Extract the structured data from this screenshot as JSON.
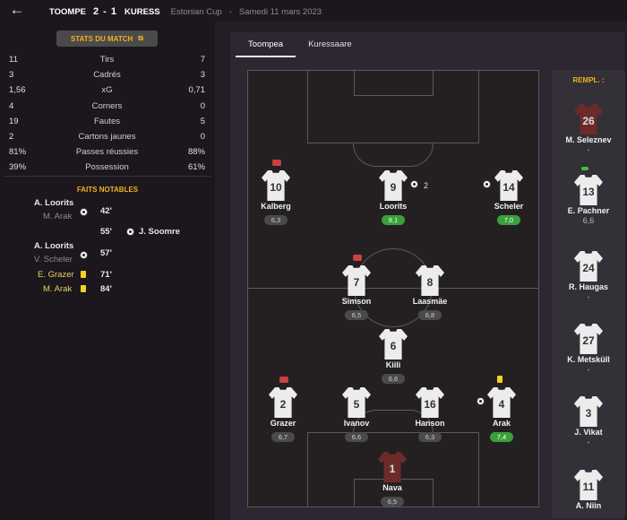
{
  "header": {
    "home": "TOOMPE",
    "score": "2 - 1",
    "away": "KURESS",
    "competition": "Estonian Cup",
    "date": "Samedi 11 mars 2023"
  },
  "stats_button": "STATS DU MATCH",
  "stats": [
    {
      "h": "11",
      "label": "Tirs",
      "a": "7"
    },
    {
      "h": "3",
      "label": "Cadrés",
      "a": "3"
    },
    {
      "h": "1,56",
      "label": "xG",
      "a": "0,71"
    },
    {
      "h": "4",
      "label": "Corners",
      "a": "0"
    },
    {
      "h": "19",
      "label": "Fautes",
      "a": "5"
    },
    {
      "h": "2",
      "label": "Cartons jaunes",
      "a": "0"
    },
    {
      "h": "81%",
      "label": "Passes réussies",
      "a": "88%"
    },
    {
      "h": "39%",
      "label": "Possession",
      "a": "61%"
    }
  ],
  "events_header": "FAITS NOTABLES",
  "events": {
    "e1_scorer": "A. Loorits",
    "e1_assist": "M. Arak",
    "e1_min": "42'",
    "e2_min": "55'",
    "e2_scorer": "J. Soomre",
    "e3_scorer": "A. Loorits",
    "e3_assist": "V. Scheler",
    "e3_min": "57'",
    "e4_player": "E. Grazer",
    "e4_min": "71'",
    "e5_player": "M. Arak",
    "e5_min": "84'"
  },
  "tabs": [
    "Toompea",
    "Kuressaare"
  ],
  "lineup": {
    "p10": {
      "num": "10",
      "name": "Kalberg",
      "rating": "6,3"
    },
    "p9": {
      "num": "9",
      "name": "Loorits",
      "rating": "9,1",
      "goals": "2"
    },
    "p14": {
      "num": "14",
      "name": "Scheler",
      "rating": "7,0"
    },
    "p7": {
      "num": "7",
      "name": "Simson",
      "rating": "6,5"
    },
    "p8": {
      "num": "8",
      "name": "Laasmäe",
      "rating": "6,8"
    },
    "p6": {
      "num": "6",
      "name": "Kiili",
      "rating": "6,6"
    },
    "p2": {
      "num": "2",
      "name": "Grazer",
      "rating": "6,7"
    },
    "p5": {
      "num": "5",
      "name": "Ivanov",
      "rating": "6,6"
    },
    "p16": {
      "num": "16",
      "name": "Hanson",
      "rating": "6,3"
    },
    "p4": {
      "num": "4",
      "name": "Arak",
      "rating": "7,4"
    },
    "p1": {
      "num": "1",
      "name": "Nava",
      "rating": "6,5"
    }
  },
  "subs_header": "REMPL. :",
  "subs": [
    {
      "num": "26",
      "name": "M. Seleznev",
      "rating": "-"
    },
    {
      "num": "13",
      "name": "E. Pachner",
      "rating": "6,6"
    },
    {
      "num": "24",
      "name": "R. Haugas",
      "rating": "-"
    },
    {
      "num": "27",
      "name": "K. Metsküll",
      "rating": "-"
    },
    {
      "num": "3",
      "name": "J. Vikat",
      "rating": "-"
    },
    {
      "num": "11",
      "name": "A. Niin",
      "rating": ""
    }
  ]
}
